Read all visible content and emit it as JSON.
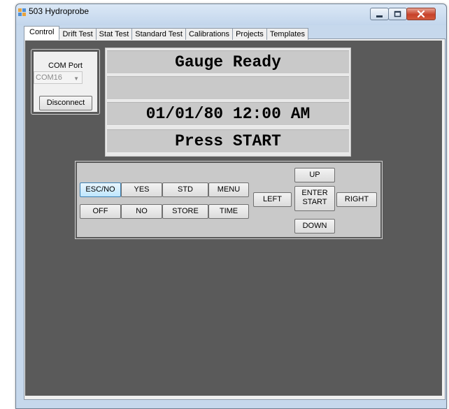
{
  "window": {
    "title": "503 Hydroprobe",
    "controls": [
      "minimize-icon",
      "maximize-icon",
      "close-icon"
    ]
  },
  "tabs": [
    {
      "label": "Control",
      "active": true
    },
    {
      "label": "Drift Test",
      "active": false
    },
    {
      "label": "Stat Test",
      "active": false
    },
    {
      "label": "Standard Test",
      "active": false
    },
    {
      "label": "Calibrations",
      "active": false
    },
    {
      "label": "Projects",
      "active": false
    },
    {
      "label": "Templates",
      "active": false
    }
  ],
  "com_port": {
    "label": "COM Port",
    "selected": "COM16",
    "disconnect_label": "Disconnect"
  },
  "display": {
    "line1": "Gauge Ready",
    "line2": "",
    "line3": "01/01/80 12:00 AM",
    "line4": "Press START"
  },
  "keypad": {
    "esc_no": "ESC/NO",
    "yes": "YES",
    "std": "STD",
    "menu": "MENU",
    "off": "OFF",
    "no": "NO",
    "store": "STORE",
    "time": "TIME",
    "left": "LEFT",
    "up": "UP",
    "enter_line1": "ENTER",
    "enter_line2": "START",
    "right": "RIGHT",
    "down": "DOWN"
  },
  "colors": {
    "panel_background": "#5a5a5a",
    "display_background": "#c9c9c9",
    "focused_button": "#bee6fd"
  }
}
